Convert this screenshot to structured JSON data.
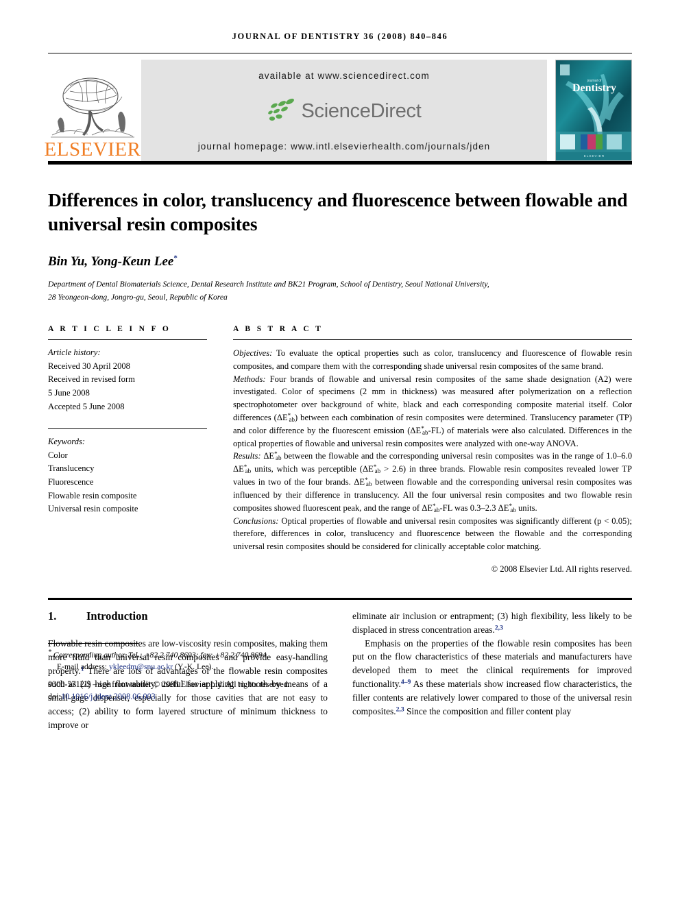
{
  "running_head": "JOURNAL OF DENTISTRY 36 (2008) 840–846",
  "masthead": {
    "publisher_name": "ELSEVIER",
    "available_at": "available at www.sciencedirect.com",
    "sciencedirect_word": "ScienceDirect",
    "journal_homepage": "journal homepage: www.intl.elsevierhealth.com/journals/jden",
    "cover_journal_prefix": "journal of",
    "cover_journal_title": "Dentistry",
    "colors": {
      "elsevier_orange": "#f07d23",
      "sciencedirect_green": "#5aa84f",
      "sciencedirect_gray": "#6e6e6e",
      "panel_gray": "#e3e3e3",
      "cover_teal": "#1d7a84"
    }
  },
  "article": {
    "title": "Differences in color, translucency and fluorescence between flowable and universal resin composites",
    "authors": "Bin Yu, Yong-Keun Lee",
    "author_marker": "*",
    "affiliation_line1": "Department of Dental Biomaterials Science, Dental Research Institute and BK21 Program, School of Dentistry, Seoul National University,",
    "affiliation_line2": "28 Yeongeon-dong, Jongro-gu, Seoul, Republic of Korea"
  },
  "article_info": {
    "heading": "A R T I C L E   I N F O",
    "history_label": "Article history:",
    "history": [
      "Received 30 April 2008",
      "Received in revised form",
      "5 June 2008",
      "Accepted 5 June 2008"
    ],
    "keywords_label": "Keywords:",
    "keywords": [
      "Color",
      "Translucency",
      "Fluorescence",
      "Flowable resin composite",
      "Universal resin composite"
    ]
  },
  "abstract": {
    "heading": "A B S T R A C T",
    "objectives_label": "Objectives:",
    "objectives_text": " To evaluate the optical properties such as color, translucency and fluorescence of flowable resin composites, and compare them with the corresponding shade universal resin composites of the same brand.",
    "methods_label": "Methods:",
    "methods_part1": " Four brands of flowable and universal resin composites of the same shade designation (A2) were investigated. Color of specimens (2 mm in thickness) was measured after polymerization on a reflection spectrophotometer over background of white, black and each corresponding composite material itself. Color differences (",
    "methods_part2": ") between each combination of resin composites were determined. Translucency parameter (TP) and color difference by the fluorescent emission (",
    "methods_part3": "-FL) of materials were also calculated. Differences in the optical properties of flowable and universal resin composites were analyzed with one-way ANOVA.",
    "results_label": "Results:",
    "results_part1": " ",
    "results_part2": " between the flowable and the corresponding universal resin composites was in the range of 1.0–6.0 ",
    "results_part3": " units, which was perceptible (",
    "results_part4": " > 2.6) in three brands. Flowable resin composites revealed lower TP values in two of the four brands. ",
    "results_part5": " between flowable and the corresponding universal resin composites was influenced by their difference in translucency. All the four universal resin composites and two flowable resin composites showed fluorescent peak, and the range of ",
    "results_part6": "-FL was 0.3–2.3 ",
    "results_part7": " units.",
    "conclusions_label": "Conclusions:",
    "conclusions_text": " Optical properties of flowable and universal resin composites was significantly different (p < 0.05); therefore, differences in color, translucency and fluorescence between the flowable and the corresponding universal resin composites should be considered for clinically acceptable color matching.",
    "delta_e_symbol": "ΔE",
    "delta_e_sup": "*",
    "delta_e_sub": "ab",
    "copyright": "© 2008 Elsevier Ltd. All rights reserved."
  },
  "introduction": {
    "number": "1.",
    "heading": "Introduction",
    "left_para1_a": "Flowable resin composites are low-viscosity resin composites, making them more fluid than universal resin composites and provide easy-handling property.",
    "left_para1_ref1": "1",
    "left_para1_b": " There are lots of advantages of the flowable resin composites such as (1) high flowability, useful for applying to tooth by means of a small-gage dispenser, especially for those cavities that are not easy to access; (2) ability to form layered structure of minimum thickness to improve or",
    "right_para1_a": "eliminate air inclusion or entrapment; (3) high flexibility, less likely to be displaced in stress concentration areas.",
    "right_para1_ref": "2,3",
    "right_para2_a": "Emphasis on the properties of the flowable resin composites has been put on the flow characteristics of these materials and manufacturers have developed them to meet the clinical requirements for improved functionality.",
    "right_para2_ref1": "4–9",
    "right_para2_b": " As these materials show increased flow characteristics, the filler contents are relatively lower compared to those of the universal resin composites.",
    "right_para2_ref2": "2,3",
    "right_para2_c": " Since the composition and filler content play"
  },
  "footnotes": {
    "corresponding_marker": "*",
    "corresponding_text": "Corresponding author. Tel.: +82 2 740 8693; fax: +82 2 740 8694.",
    "email_label": "E-mail address:",
    "email": "ykleedm@snu.ac.kr",
    "email_suffix": "(Y.-K. Lee).",
    "imprint": "0300-5712/$ – see front matter © 2008 Elsevier Ltd. All rights reserved.",
    "doi_label": "doi:",
    "doi": "10.1016/j.jdent.2008.06.003"
  }
}
